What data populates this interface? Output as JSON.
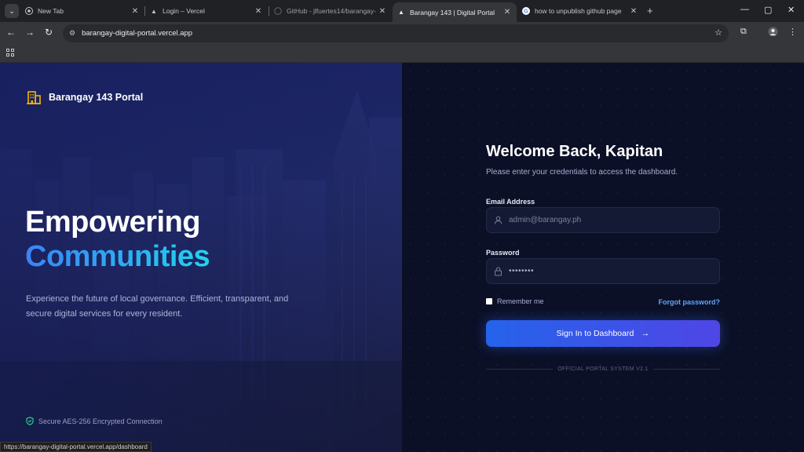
{
  "browser": {
    "tabs": [
      {
        "title": "New Tab",
        "icon": "chrome-icon"
      },
      {
        "title": "Login – Vercel",
        "icon": "vercel-icon"
      },
      {
        "title": "GitHub - jlfuertes14/barangay-",
        "icon": "github-icon"
      },
      {
        "title": "Barangay 143 | Digital Portal",
        "icon": "vercel-icon",
        "active": true
      },
      {
        "title": "how to unpublish github page",
        "icon": "google-icon"
      }
    ],
    "url": "barangay-digital-portal.vercel.app",
    "status_url": "https://barangay-digital-portal.vercel.app/dashboard"
  },
  "hero": {
    "brand": "Barangay 143 Portal",
    "headline_line1": "Empowering",
    "headline_line2": "Communities",
    "tagline": "Experience the future of local governance. Efficient, transparent, and secure digital services for every resident.",
    "secure_note": "Secure AES-256 Encrypted Connection"
  },
  "login": {
    "title": "Welcome Back, Kapitan",
    "subtitle": "Please enter your credentials to access the dashboard.",
    "email_label": "Email Address",
    "email_placeholder": "admin@barangay.ph",
    "password_label": "Password",
    "password_value": "••••••••",
    "remember_label": "Remember me",
    "forgot_label": "Forgot password?",
    "signin_label": "Sign In to Dashboard",
    "footer": "OFFICIAL PORTAL SYSTEM V2.1"
  },
  "colors": {
    "accent_blue": "#2563eb",
    "accent_indigo": "#4f46e5",
    "link": "#60a5fa",
    "brand_icon": "#f5b500",
    "secure_icon": "#34d399"
  }
}
